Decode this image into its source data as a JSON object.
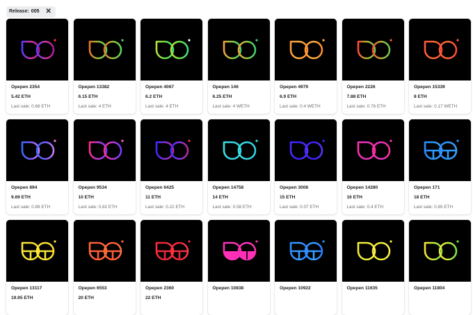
{
  "filter": {
    "label": "Release:",
    "value": "005",
    "close_icon": "close-icon"
  },
  "cards": [
    {
      "name": "Opepen 2354",
      "price": "5.42 ETH",
      "last_sale": "Last sale: 0.68 ETH",
      "shape": "circle",
      "colors": [
        "#5b3bff",
        "#d63aa8",
        "#b5179e"
      ],
      "dot": "#ff2d55"
    },
    {
      "name": "Opepen 13382",
      "price": "6.15 ETH",
      "last_sale": "Last sale: 4 ETH",
      "shape": "circle",
      "colors": [
        "#e8742c",
        "#9bc23a",
        "#5fd35a"
      ],
      "dot": "#62d66a"
    },
    {
      "name": "Opepen 4067",
      "price": "6.2 ETH",
      "last_sale": "Last sale: 4 ETH",
      "shape": "circle",
      "colors": [
        "#b8e33c",
        "#6ee04a",
        "#3de07a"
      ],
      "dot": "#ffffff"
    },
    {
      "name": "Opepen 146",
      "price": "6.25 ETH",
      "last_sale": "Last sale: 4 WETH",
      "shape": "circle",
      "colors": [
        "#f3a338",
        "#8dd04a",
        "#3fd06d"
      ],
      "dot": "#3fd06d"
    },
    {
      "name": "Opepen 4979",
      "price": "6.9 ETH",
      "last_sale": "Last sale: 0.4 WETH",
      "shape": "split",
      "colors": [
        "#ff9a3c",
        "#ffb347",
        "#ff8a2a"
      ],
      "dot": "#ffb347"
    },
    {
      "name": "Opepen 2226",
      "price": "7.88 ETH",
      "last_sale": "Last sale: 0.76 ETH",
      "shape": "circle",
      "colors": [
        "#ff4b3a",
        "#b7b63a",
        "#6fc24f"
      ],
      "dot": "#ff5b4a"
    },
    {
      "name": "Opepen 15339",
      "price": "8 ETH",
      "last_sale": "Last sale: 0.17 WETH",
      "shape": "split",
      "colors": [
        "#ff5a3d",
        "#ff6b3a",
        "#ff4a2f"
      ],
      "dot": "#ff5a3d"
    },
    {
      "name": "Opepen 894",
      "price": "9.69 ETH",
      "last_sale": "Last sale: 0.89 ETH",
      "shape": "circle",
      "colors": [
        "#3a6bff",
        "#7a5bff",
        "#c77dff"
      ],
      "dot": "#ff77ff"
    },
    {
      "name": "Opepen 9534",
      "price": "10 ETH",
      "last_sale": "Last sale: 0.82 ETH",
      "shape": "circle",
      "colors": [
        "#ff2d8a",
        "#c23adf",
        "#7a3bff"
      ],
      "dot": "#ff6fb0"
    },
    {
      "name": "Opepen 6425",
      "price": "11 ETH",
      "last_sale": "Last sale: 0.22 ETH",
      "shape": "circle",
      "colors": [
        "#3b2bff",
        "#8a35e0",
        "#b52aa0"
      ],
      "dot": "#ff2d55"
    },
    {
      "name": "Opepen 14758",
      "price": "14 ETH",
      "last_sale": "Last sale: 0.58 ETH",
      "shape": "split",
      "colors": [
        "#35e6e0",
        "#3ad8e8",
        "#2fd5e6"
      ],
      "dot": "#3ee6e0"
    },
    {
      "name": "Opepen 3008",
      "price": "15 ETH",
      "last_sale": "Last sale: 0.07 ETH",
      "shape": "split",
      "colors": [
        "#4a2bff",
        "#3b1fff",
        "#5a35ff"
      ],
      "dot": "#3b2bff"
    },
    {
      "name": "Opepen 14280",
      "price": "16 ETH",
      "last_sale": "Last sale: 0.4 ETH",
      "shape": "split",
      "colors": [
        "#ff2fb0",
        "#e635c8",
        "#ff2f9a"
      ],
      "dot": "#ff3fa8"
    },
    {
      "name": "Opepen 171",
      "price": "18 ETH",
      "last_sale": "Last sale: 0.65 ETH",
      "shape": "cross",
      "colors": [
        "#2a8bff",
        "#2f9cff",
        "#3aa0ff"
      ],
      "dot": "#2f9cff"
    },
    {
      "name": "Opepen 13117",
      "price": "19.95 ETH",
      "last_sale": "",
      "shape": "cross",
      "colors": [
        "#ffe93a",
        "#f6e23a",
        "#ffe02f"
      ],
      "dot": "#ffe93a"
    },
    {
      "name": "Opepen 6553",
      "price": "20 ETH",
      "last_sale": "",
      "shape": "cross",
      "colors": [
        "#ff6a3a",
        "#ff5a35",
        "#ff7040"
      ],
      "dot": "#ff6a3a"
    },
    {
      "name": "Opepen 2360",
      "price": "22 ETH",
      "last_sale": "",
      "shape": "cross",
      "colors": [
        "#ff2a3d",
        "#e8263a",
        "#ff3a4a"
      ],
      "dot": "#ff2a3d"
    },
    {
      "name": "Opepen 10838",
      "price": "",
      "last_sale": "",
      "shape": "filled",
      "colors": [
        "#ff2fb8",
        "#ff38c0",
        "#ff2fb0"
      ],
      "dot": "#ff2fb8"
    },
    {
      "name": "Opepen 10922",
      "price": "",
      "last_sale": "",
      "shape": "cross",
      "colors": [
        "#2f8fff",
        "#3aa0ff",
        "#2a7dff"
      ],
      "dot": "#2f8fff"
    },
    {
      "name": "Opepen 11635",
      "price": "",
      "last_sale": "",
      "shape": "split",
      "colors": [
        "#f6ee3a",
        "#eaf03a",
        "#fff04a"
      ],
      "dot": "#f6ee3a"
    },
    {
      "name": "Opepen 11804",
      "price": "",
      "last_sale": "",
      "shape": "circle",
      "colors": [
        "#f6e83a",
        "#c8ec3a",
        "#7fe04a"
      ],
      "dot": "#7fe04a"
    }
  ]
}
